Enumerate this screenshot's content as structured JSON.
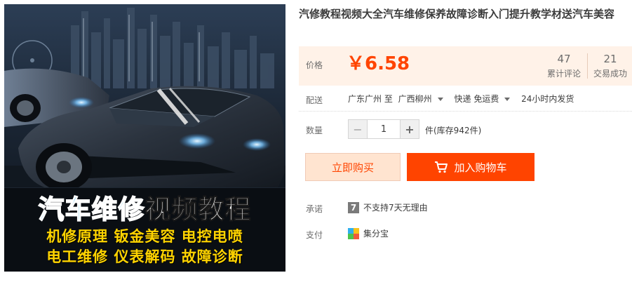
{
  "product": {
    "title": "汽修教程视频大全汽车维修保养故障诊断入门提升教学材送汽车美容",
    "image": {
      "banner_highlight": "汽车维修",
      "banner_main": "视频教程",
      "sub_row_1": "机修原理  钣金美容  电控电喷",
      "sub_row_2": "电工维修  仪表解码  故障诊断"
    }
  },
  "price": {
    "label": "价格",
    "value": "￥6.58",
    "reviews_count": "47",
    "reviews_label": "累计评论",
    "sales_count": "21",
    "sales_label": "交易成功"
  },
  "shipping": {
    "label": "配送",
    "from": "广东广州 至",
    "to": "广西柳州",
    "method": "快递 免运费",
    "dispatch": "24小时内发货"
  },
  "quantity": {
    "label": "数量",
    "minus": "−",
    "value": "1",
    "plus": "+",
    "stock_text": "件(库存942件)"
  },
  "actions": {
    "buy_now": "立即购买",
    "add_cart": "加入购物车"
  },
  "promise": {
    "label": "承诺",
    "icon_char": "7",
    "text": "不支持7天无理由"
  },
  "payment": {
    "label": "支付",
    "method": "集分宝"
  },
  "colors": {
    "accent": "#ff4400",
    "price_bg": "#fff2e8",
    "buy_now_bg": "#ffe4d0",
    "banner_blue": "#16a8e8",
    "banner_yellow": "#ffd400"
  },
  "icons": [
    "seven-day-icon",
    "jifenbao-icon",
    "cart-icon",
    "caret-down-icon"
  ]
}
